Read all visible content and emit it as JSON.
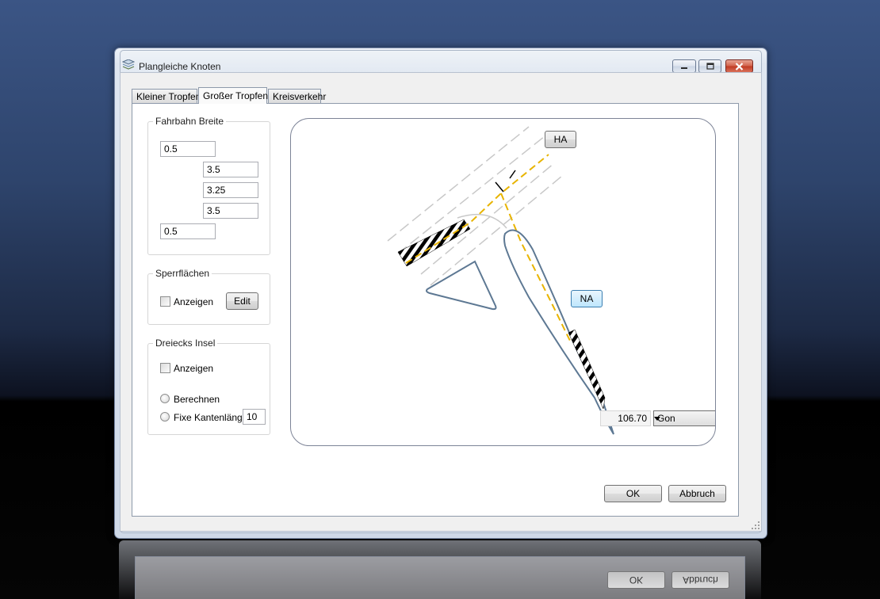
{
  "window": {
    "title": "Plangleiche Knoten",
    "controls": {
      "minimize": "minimize-icon",
      "maximize": "maximize-icon",
      "close": "close-icon"
    }
  },
  "tabs": [
    {
      "label": "Kleiner Tropfen",
      "active": false
    },
    {
      "label": "Großer Tropfen",
      "active": true
    },
    {
      "label": "Kreisverkehr",
      "active": false
    }
  ],
  "fahrbahn": {
    "legend": "Fahrbahn Breite",
    "values": [
      "0.5",
      "3.5",
      "3.25",
      "3.5",
      "0.5"
    ]
  },
  "sperrflaechen": {
    "legend": "Sperrflächen",
    "anzeigen_label": "Anzeigen",
    "anzeigen_checked": false,
    "edit_label": "Edit"
  },
  "dreieck": {
    "legend": "Dreiecks Insel",
    "anzeigen_label": "Anzeigen",
    "anzeigen_checked": false,
    "berechnen_label": "Berechnen",
    "fixe_label": "Fixe Kantenlänge",
    "fixe_value": "10"
  },
  "preview": {
    "ha_label": "HA",
    "na_label": "NA",
    "angle_value": "106.70",
    "angle_unit": "Gon"
  },
  "footer": {
    "ok_label": "OK",
    "cancel_label": "Abbruch"
  },
  "colors": {
    "accent_line": "#e8b400",
    "island_stroke": "#5d7893",
    "guide_line": "#c8c8c8"
  }
}
